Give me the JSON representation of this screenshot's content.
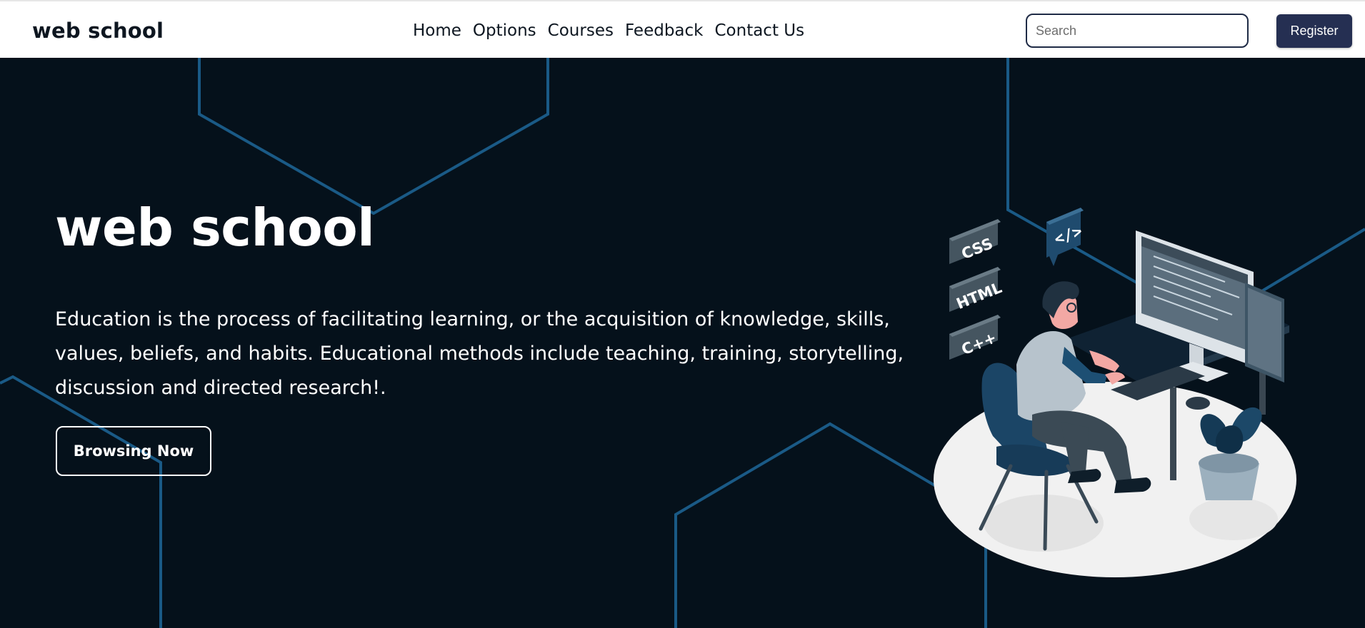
{
  "nav": {
    "brand": "web school",
    "links": [
      "Home",
      "Options",
      "Courses",
      "Feedback",
      "Contact Us"
    ],
    "search_placeholder": "Search",
    "register_label": "Register"
  },
  "hero": {
    "title": "web school",
    "description": "Education is the process of facilitating learning, or the acquisition of knowledge, skills, values, beliefs, and habits. Educational methods include teaching, training, storytelling, discussion and directed research!.",
    "button_label": "Browsing Now"
  },
  "illustration": {
    "tags": [
      "CSS",
      "HTML",
      "C++"
    ],
    "code_bubble": "</>"
  },
  "colors": {
    "hero_bg": "#05111b",
    "hex_lines": "#1a5a86",
    "register_bg": "#252f52",
    "navbar_bg": "#ffffff"
  }
}
